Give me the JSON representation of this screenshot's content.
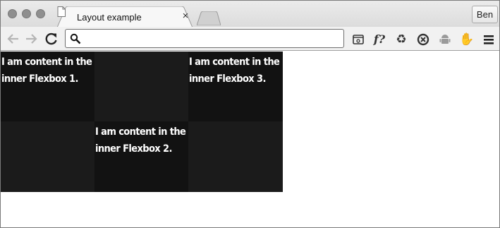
{
  "browser": {
    "tab": {
      "title": "Layout example",
      "close_glyph": "×",
      "icon": "document-icon"
    },
    "profile_label": "Ben",
    "omnibox": {
      "value": "",
      "placeholder": ""
    },
    "toolbar_icons": [
      "back-arrow-icon",
      "forward-arrow-icon",
      "reload-icon",
      "search-icon",
      "reading-list-icon",
      "font-finder-icon",
      "recycle-icon",
      "sync-icon",
      "android-icon",
      "hand-icon",
      "menu-icon"
    ],
    "extensions": {
      "font_finder_label": "f?"
    }
  },
  "page": {
    "boxes": [
      {
        "text": "I am content in the inner Flexbox 1."
      },
      {
        "text": ""
      },
      {
        "text": "I am content in the inner Flexbox 3."
      },
      {
        "text": ""
      },
      {
        "text": "I am content in the inner Flexbox 2."
      },
      {
        "text": ""
      }
    ],
    "colors": {
      "box_dark": "#121212",
      "box_mid": "#1b1b1b",
      "text": "#ffffff"
    }
  }
}
